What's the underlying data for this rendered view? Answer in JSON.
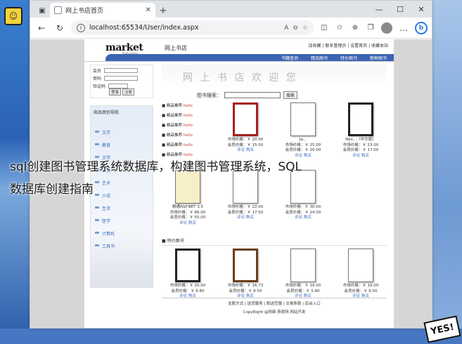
{
  "browser": {
    "tab_title": "网上书店首页",
    "url": "localhost:65534/User/index.aspx",
    "nav_icons": [
      "back-icon",
      "refresh-icon"
    ],
    "ext_icons": [
      "reader-icon",
      "zoom-icon",
      "favorite-icon",
      "split-icon",
      "favorites-bar-icon",
      "collections-icon",
      "extensions-icon"
    ]
  },
  "site": {
    "logo": "market",
    "logo_cn": "网上书店",
    "logo_sub": "Saturday",
    "toplinks": "加收藏 | 联系管理员 | 设置首页 | 收藏本站",
    "nav": [
      "书籍查询",
      "精品图书",
      "特价图书",
      "新鲜图书"
    ],
    "banner": "网 上 书 店 欢 迎 您",
    "login": {
      "user_label": "会员",
      "pwd_label": "密码",
      "code_label": "验证码",
      "login_btn": "登录",
      "register_btn": "注册"
    },
    "category_title": "商品类别导航",
    "categories": [
      "文学",
      "教育",
      "文学",
      "法律",
      "艺术",
      "小说",
      "生活",
      "医学",
      "计算机",
      "工具书"
    ],
    "search_label": "图书搜索：",
    "search_btn": "搜索",
    "rec_label": "精品推荐",
    "rec_flag": "hello",
    "products_row1": [
      {
        "name": "",
        "price": "市场价格：￥ 20.00",
        "member": "会员价格：￥ 15.00",
        "actions": "评论 购买"
      },
      {
        "name": "Ja...",
        "price": "市场价格：￥ 25.00",
        "member": "会员价格：￥ 20.00",
        "actions": "评论 购买"
      },
      {
        "name": "Nex...（中文版）",
        "price": "市场价格：￥ 23.00",
        "member": "会员价格：￥ 17.00",
        "actions": "评论 购买"
      }
    ],
    "products_row2": [
      {
        "name": "精通ASP.NET 3.5",
        "price": "市场价格：￥ 86.00",
        "member": "会员价格：￥ 55.00",
        "actions": "评论 购买"
      },
      {
        "name": "",
        "price": "市场价格：￥ 22.00",
        "member": "会员价格：￥ 17.50",
        "actions": "评论 购买"
      },
      {
        "name": "",
        "price": "市场价格：￥ 30.00",
        "member": "会员价格：￥ 24.00",
        "actions": "评论 购买"
      }
    ],
    "special_title": "特价图书",
    "products_row3": [
      {
        "name": "",
        "price": "市场价格：￥ 20.00",
        "member": "会员价格：￥ 6.80",
        "actions": "评论 购买"
      },
      {
        "name": "",
        "price": "市场价格：￥ 16.73",
        "member": "会员价格：￥ 8.50",
        "actions": "评论 购买"
      },
      {
        "name": "",
        "price": "市场价格：￥ 16.00",
        "member": "会员价格：￥ 5.80",
        "actions": "评论 购买"
      },
      {
        "name": "",
        "price": "市场价格：￥ 19.00",
        "member": "会员价格：￥ 6.50",
        "actions": "评论 购买"
      }
    ],
    "footer_links": "支配方式 | 送货服务 | 配送范围 | 交易条款 | 后台入口",
    "footer_copy": "CopyRight   @网络   恭贺网   网站开发"
  },
  "caption": {
    "line1": "sql创建图书管理系统数据库，构建图书管理系统，SQL",
    "line2": "数据库创建指南"
  },
  "stickers": {
    "yes": "YES!"
  }
}
